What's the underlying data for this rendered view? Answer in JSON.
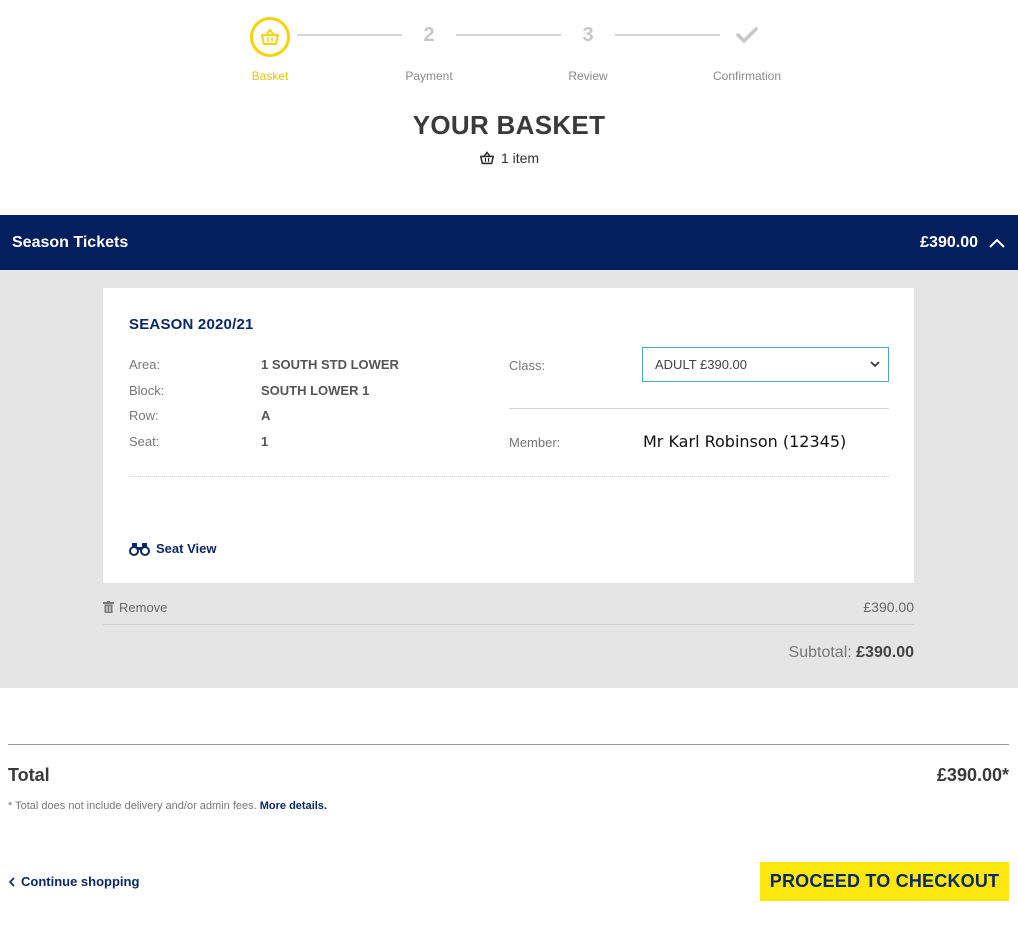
{
  "stepper": {
    "steps": [
      {
        "label": "Basket",
        "number": "",
        "state": "active",
        "icon": "basket-icon"
      },
      {
        "label": "Payment",
        "number": "2",
        "state": "pending"
      },
      {
        "label": "Review",
        "number": "3",
        "state": "pending"
      },
      {
        "label": "Confirmation",
        "number": "",
        "state": "pending",
        "icon": "check-icon"
      }
    ]
  },
  "header": {
    "title": "YOUR BASKET",
    "item_count": "1 item"
  },
  "section": {
    "title": "Season Tickets",
    "total": "£390.00",
    "expanded": true
  },
  "item": {
    "season": "SEASON 2020/21",
    "details": [
      {
        "key": "Area:",
        "value": "1 SOUTH STD LOWER"
      },
      {
        "key": "Block:",
        "value": "SOUTH LOWER 1"
      },
      {
        "key": "Row:",
        "value": "A"
      },
      {
        "key": "Seat:",
        "value": "1"
      }
    ],
    "class_label": "Class:",
    "class_value": "ADULT £390.00",
    "member_label": "Member:",
    "member_value": "Mr Karl Robinson (12345)",
    "seat_view": "Seat View",
    "remove": "Remove",
    "price": "£390.00"
  },
  "subtotal": {
    "label": "Subtotal:",
    "value": "£390.00"
  },
  "total": {
    "label": "Total",
    "value": "£390.00*",
    "note": "* Total does not include delivery and/or admin fees.",
    "note_link": "More details."
  },
  "actions": {
    "continue": "Continue shopping",
    "checkout": "PROCEED TO CHECKOUT"
  },
  "colors": {
    "navy": "#031f5e",
    "accent_yellow": "#fce70e",
    "active_step": "#f5d20c"
  }
}
